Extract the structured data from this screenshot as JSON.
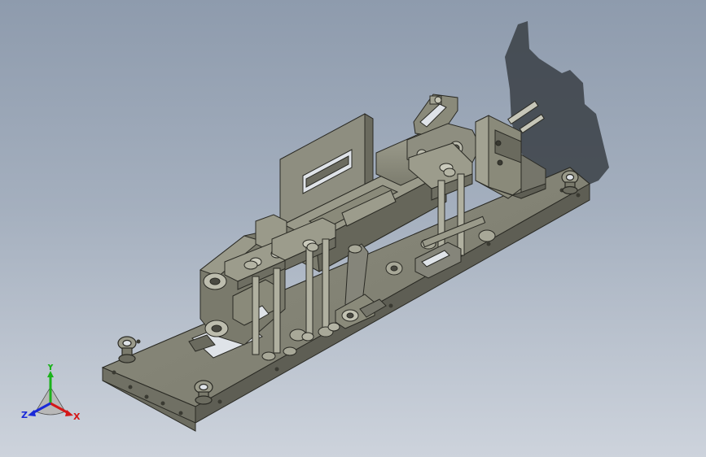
{
  "viewport": {
    "background_top": "#8e9bad",
    "background_bottom": "#cdd3dc",
    "model_color": "#8a8a7a",
    "model_edge_color": "#2a2a24"
  },
  "triad": {
    "x_label": "X",
    "y_label": "Y",
    "z_label": "Z",
    "x_color": "#d41818",
    "y_color": "#1bb21b",
    "z_color": "#1a2ad8"
  }
}
